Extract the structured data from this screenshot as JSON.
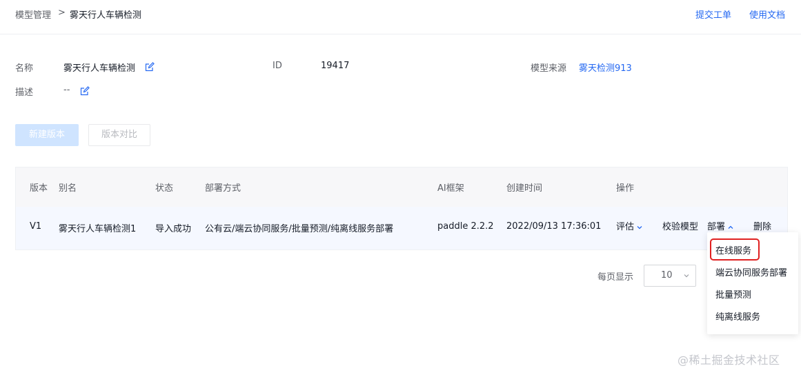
{
  "breadcrumb": {
    "parent": "模型管理",
    "separator": ">",
    "current": "雾天行人车辆检测"
  },
  "top_links": {
    "submit_ticket": "提交工单",
    "docs": "使用文档"
  },
  "info": {
    "name_label": "名称",
    "name_value": "雾天行人车辆检测",
    "id_label": "ID",
    "id_value": "19417",
    "source_label": "模型来源",
    "source_value": "雾天检测913",
    "desc_label": "描述",
    "desc_value": "--"
  },
  "buttons": {
    "new_version": "新建版本",
    "compare_versions": "版本对比"
  },
  "table": {
    "headers": [
      "版本",
      "别名",
      "状态",
      "部署方式",
      "AI框架",
      "创建时间",
      "操作"
    ],
    "rows": [
      {
        "version": "V1",
        "alias": "雾天行人车辆检测1",
        "status": "导入成功",
        "deploy": "公有云/端云协同服务/批量预测/纯离线服务部署",
        "framework": "paddle  2.2.2",
        "created": "2022/09/13 17:36:01",
        "actions": {
          "evaluate": "评估",
          "validate": "校验模型",
          "deploy": "部署",
          "delete": "删除"
        }
      }
    ]
  },
  "deploy_menu": {
    "items": [
      "在线服务",
      "端云协同服务部署",
      "批量预测",
      "纯离线服务"
    ],
    "highlighted_index": 0
  },
  "pagination": {
    "per_page_label": "每页显示",
    "per_page_value": "10"
  },
  "watermark": "@稀土掘金技术社区",
  "colors": {
    "link": "#2468f2",
    "highlight_border": "#e02020",
    "primary_disabled": "#cfe4ff"
  }
}
